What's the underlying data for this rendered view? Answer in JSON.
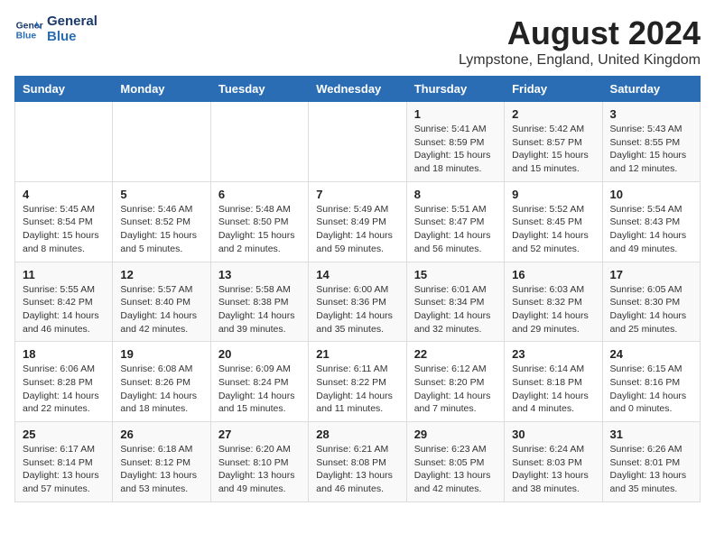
{
  "header": {
    "logo_line1": "General",
    "logo_line2": "Blue",
    "month_year": "August 2024",
    "location": "Lympstone, England, United Kingdom"
  },
  "days_of_week": [
    "Sunday",
    "Monday",
    "Tuesday",
    "Wednesday",
    "Thursday",
    "Friday",
    "Saturday"
  ],
  "weeks": [
    [
      {
        "day": "",
        "info": ""
      },
      {
        "day": "",
        "info": ""
      },
      {
        "day": "",
        "info": ""
      },
      {
        "day": "",
        "info": ""
      },
      {
        "day": "1",
        "info": "Sunrise: 5:41 AM\nSunset: 8:59 PM\nDaylight: 15 hours\nand 18 minutes."
      },
      {
        "day": "2",
        "info": "Sunrise: 5:42 AM\nSunset: 8:57 PM\nDaylight: 15 hours\nand 15 minutes."
      },
      {
        "day": "3",
        "info": "Sunrise: 5:43 AM\nSunset: 8:55 PM\nDaylight: 15 hours\nand 12 minutes."
      }
    ],
    [
      {
        "day": "4",
        "info": "Sunrise: 5:45 AM\nSunset: 8:54 PM\nDaylight: 15 hours\nand 8 minutes."
      },
      {
        "day": "5",
        "info": "Sunrise: 5:46 AM\nSunset: 8:52 PM\nDaylight: 15 hours\nand 5 minutes."
      },
      {
        "day": "6",
        "info": "Sunrise: 5:48 AM\nSunset: 8:50 PM\nDaylight: 15 hours\nand 2 minutes."
      },
      {
        "day": "7",
        "info": "Sunrise: 5:49 AM\nSunset: 8:49 PM\nDaylight: 14 hours\nand 59 minutes."
      },
      {
        "day": "8",
        "info": "Sunrise: 5:51 AM\nSunset: 8:47 PM\nDaylight: 14 hours\nand 56 minutes."
      },
      {
        "day": "9",
        "info": "Sunrise: 5:52 AM\nSunset: 8:45 PM\nDaylight: 14 hours\nand 52 minutes."
      },
      {
        "day": "10",
        "info": "Sunrise: 5:54 AM\nSunset: 8:43 PM\nDaylight: 14 hours\nand 49 minutes."
      }
    ],
    [
      {
        "day": "11",
        "info": "Sunrise: 5:55 AM\nSunset: 8:42 PM\nDaylight: 14 hours\nand 46 minutes."
      },
      {
        "day": "12",
        "info": "Sunrise: 5:57 AM\nSunset: 8:40 PM\nDaylight: 14 hours\nand 42 minutes."
      },
      {
        "day": "13",
        "info": "Sunrise: 5:58 AM\nSunset: 8:38 PM\nDaylight: 14 hours\nand 39 minutes."
      },
      {
        "day": "14",
        "info": "Sunrise: 6:00 AM\nSunset: 8:36 PM\nDaylight: 14 hours\nand 35 minutes."
      },
      {
        "day": "15",
        "info": "Sunrise: 6:01 AM\nSunset: 8:34 PM\nDaylight: 14 hours\nand 32 minutes."
      },
      {
        "day": "16",
        "info": "Sunrise: 6:03 AM\nSunset: 8:32 PM\nDaylight: 14 hours\nand 29 minutes."
      },
      {
        "day": "17",
        "info": "Sunrise: 6:05 AM\nSunset: 8:30 PM\nDaylight: 14 hours\nand 25 minutes."
      }
    ],
    [
      {
        "day": "18",
        "info": "Sunrise: 6:06 AM\nSunset: 8:28 PM\nDaylight: 14 hours\nand 22 minutes."
      },
      {
        "day": "19",
        "info": "Sunrise: 6:08 AM\nSunset: 8:26 PM\nDaylight: 14 hours\nand 18 minutes."
      },
      {
        "day": "20",
        "info": "Sunrise: 6:09 AM\nSunset: 8:24 PM\nDaylight: 14 hours\nand 15 minutes."
      },
      {
        "day": "21",
        "info": "Sunrise: 6:11 AM\nSunset: 8:22 PM\nDaylight: 14 hours\nand 11 minutes."
      },
      {
        "day": "22",
        "info": "Sunrise: 6:12 AM\nSunset: 8:20 PM\nDaylight: 14 hours\nand 7 minutes."
      },
      {
        "day": "23",
        "info": "Sunrise: 6:14 AM\nSunset: 8:18 PM\nDaylight: 14 hours\nand 4 minutes."
      },
      {
        "day": "24",
        "info": "Sunrise: 6:15 AM\nSunset: 8:16 PM\nDaylight: 14 hours\nand 0 minutes."
      }
    ],
    [
      {
        "day": "25",
        "info": "Sunrise: 6:17 AM\nSunset: 8:14 PM\nDaylight: 13 hours\nand 57 minutes."
      },
      {
        "day": "26",
        "info": "Sunrise: 6:18 AM\nSunset: 8:12 PM\nDaylight: 13 hours\nand 53 minutes."
      },
      {
        "day": "27",
        "info": "Sunrise: 6:20 AM\nSunset: 8:10 PM\nDaylight: 13 hours\nand 49 minutes."
      },
      {
        "day": "28",
        "info": "Sunrise: 6:21 AM\nSunset: 8:08 PM\nDaylight: 13 hours\nand 46 minutes."
      },
      {
        "day": "29",
        "info": "Sunrise: 6:23 AM\nSunset: 8:05 PM\nDaylight: 13 hours\nand 42 minutes."
      },
      {
        "day": "30",
        "info": "Sunrise: 6:24 AM\nSunset: 8:03 PM\nDaylight: 13 hours\nand 38 minutes."
      },
      {
        "day": "31",
        "info": "Sunrise: 6:26 AM\nSunset: 8:01 PM\nDaylight: 13 hours\nand 35 minutes."
      }
    ]
  ],
  "colors": {
    "header_bg": "#2a6db5",
    "header_text": "#ffffff",
    "title_color": "#222222",
    "accent": "#2a6db5"
  }
}
